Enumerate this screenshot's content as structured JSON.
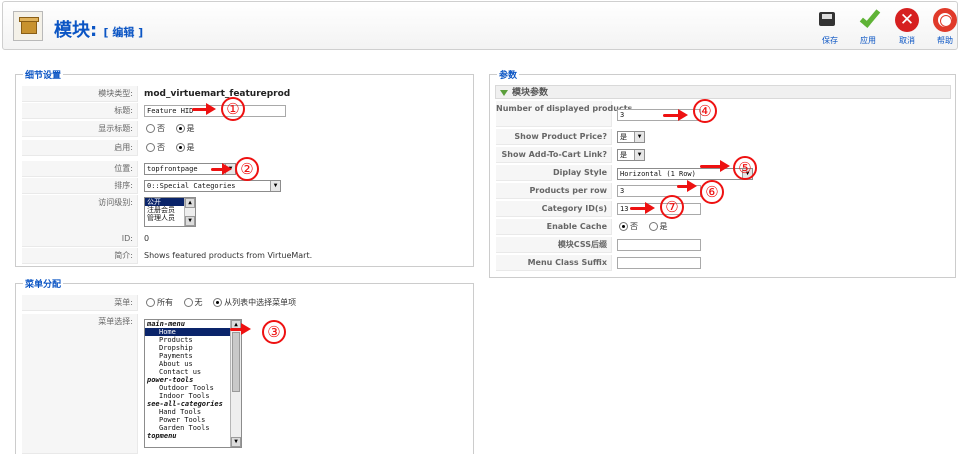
{
  "toolbar": {
    "title": "模块:",
    "subtitle": "[ 编辑 ]",
    "buttons": {
      "save": "保存",
      "apply": "应用",
      "cancel": "取消",
      "help": "帮助"
    },
    "icons": {
      "module": "module-icon",
      "save": "save-icon",
      "apply": "apply-icon",
      "cancel": "cancel-icon",
      "help": "help-icon"
    }
  },
  "details": {
    "legend": "细节设置",
    "module_type_label": "模块类型:",
    "module_type_value": "mod_virtuemart_featureprod",
    "title_label": "标题:",
    "title_value": "Feature HID",
    "show_title_label": "显示标题:",
    "show_title_options": [
      "否",
      "是"
    ],
    "show_title_selected": "是",
    "enabled_label": "启用:",
    "enabled_options": [
      "否",
      "是"
    ],
    "enabled_selected": "是",
    "position_label": "位置:",
    "position_value": "topfrontpage",
    "order_label": "排序:",
    "order_value": "0::Special Categories",
    "access_label": "访问级别:",
    "access_options": [
      "公开",
      "注册会员",
      "管理人员"
    ],
    "access_selected": "公开",
    "id_label": "ID:",
    "id_value": "0",
    "description_label": "简介:",
    "description_value": "Shows featured products from VirtueMart."
  },
  "menu_assignment": {
    "legend": "菜单分配",
    "menu_label": "菜单:",
    "menu_options": [
      "所有",
      "无",
      "从列表中选择菜单项"
    ],
    "menu_selected": "从列表中选择菜单项",
    "menu_select_label": "菜单选择:",
    "menu_items": [
      {
        "text": "main-menu",
        "group": true
      },
      {
        "text": "Home",
        "selected": true
      },
      {
        "text": "Products"
      },
      {
        "text": "Dropship"
      },
      {
        "text": "Payments"
      },
      {
        "text": "About us"
      },
      {
        "text": "Contact us"
      },
      {
        "text": "power-tools",
        "group": true
      },
      {
        "text": "Outdoor Tools"
      },
      {
        "text": "Indoor Tools"
      },
      {
        "text": "see-all-categories",
        "group": true
      },
      {
        "text": "Hand Tools"
      },
      {
        "text": "Power Tools"
      },
      {
        "text": "Garden Tools"
      },
      {
        "text": "topmenu",
        "group": true
      }
    ]
  },
  "params": {
    "legend": "参数",
    "panel_title": "模块参数",
    "num_displayed_label": "Number of displayed products",
    "num_displayed_value": "3",
    "show_price_label": "Show Product Price?",
    "show_price_value": "是",
    "show_addtocart_label": "Show Add-To-Cart Link?",
    "show_addtocart_value": "是",
    "display_style_label": "Diplay Style",
    "display_style_value": "Horizontal (1 Row)",
    "per_row_label": "Products per row",
    "per_row_value": "3",
    "category_label": "Category ID(s)",
    "category_value": "13",
    "cache_label": "Enable Cache",
    "cache_options": [
      "否",
      "是"
    ],
    "cache_selected": "否",
    "css_suffix_label": "模块CSS后缀",
    "css_suffix_value": "",
    "menu_suffix_label": "Menu Class Suffix",
    "menu_suffix_value": ""
  },
  "annotations": [
    "①",
    "②",
    "③",
    "④",
    "⑤",
    "⑥",
    "⑦"
  ],
  "colors": {
    "accent_blue": "#0b55c4",
    "annotation_red": "#ee1111",
    "selected_bg": "#0a246a"
  }
}
